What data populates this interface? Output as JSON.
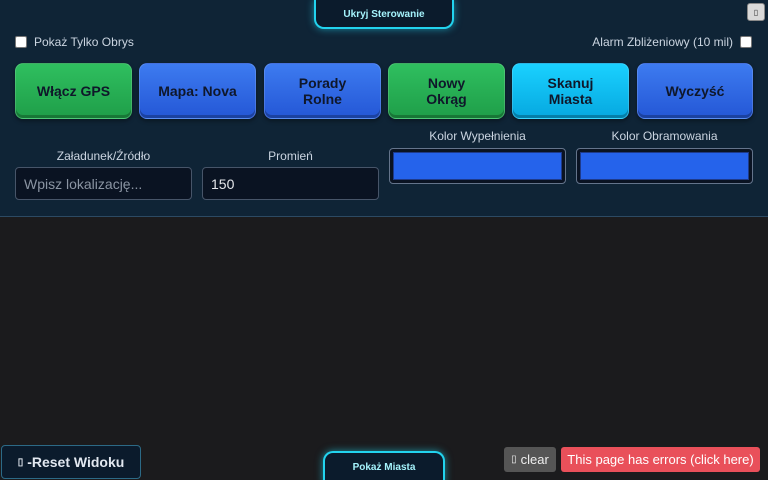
{
  "top_tab": {
    "label": "Ukryj Sterowanie"
  },
  "corner_button": {
    "icon": "unknown-glyph",
    "glyph": "▯"
  },
  "options": {
    "outline_only_label": "Pokaż Tylko Obrys",
    "outline_only_checked": false,
    "proximity_alarm_label": "Alarm Zbliżeniowy (10 mil)",
    "proximity_alarm_checked": false
  },
  "buttons": [
    {
      "label": "Włącz GPS",
      "color": "#1f9e49"
    },
    {
      "label": "Mapa: Nova",
      "color": "#2457d6"
    },
    {
      "label": "Porady Rolne",
      "color": "#2457d6"
    },
    {
      "label": "Nowy Okrąg",
      "color": "#1f9e49"
    },
    {
      "label": "Skanuj Miasta",
      "color": "#06a8e0"
    },
    {
      "label": "Wyczyść",
      "color": "#2457d6"
    }
  ],
  "fields": {
    "source_label": "Załadunek/Źródło",
    "source_placeholder": "Wpisz lokalizację...",
    "source_value": "",
    "radius_label": "Promień",
    "radius_value": "150",
    "fill_color_label": "Kolor Wypełnienia",
    "fill_color_value": "#2563eb",
    "border_color_label": "Kolor Obramowania",
    "border_color_value": "#2563eb"
  },
  "bottom": {
    "reset_label": "-Reset Widoku",
    "reset_glyph": "▯",
    "show_cities_label": "Pokaż Miasta",
    "clear_label": "clear",
    "clear_glyph": "▯",
    "errors_label": "This page has errors (click here)"
  }
}
